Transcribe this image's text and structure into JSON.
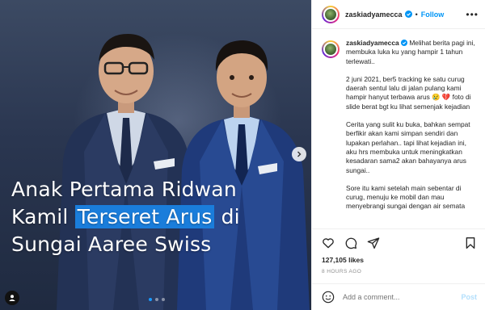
{
  "media": {
    "caption_lines": [
      {
        "parts": [
          "Anak Pertama Ridwan"
        ]
      },
      {
        "before": "Kamil ",
        "highlight": "Terseret Arus",
        "after": " di"
      },
      {
        "parts": [
          "Sungai Aaree Swiss"
        ]
      }
    ],
    "carousel": {
      "total": 3,
      "active": 0
    },
    "next_icon": "chevron-right-icon",
    "tag_icon": "person-tag-icon"
  },
  "post": {
    "username": "zaskiadyamecca",
    "follow_label": "Follow",
    "bullet": "•",
    "more_label": "•••",
    "caption_paragraphs": [
      "Melihat berita pagi ini, membuka luka ku yang hampir 1 tahun terlewati..",
      "2 juni 2021, ber5 tracking ke satu curug daerah sentul lalu di jalan pulang kami hampir hanyut terbawa arus 😢 💔 foto di slide berat bgt ku lihat semenjak kejadian",
      "Cerita yang sulit ku buka, bahkan sempat berfikir akan kami simpan sendiri dan lupakan perlahan.. tapi lihat kejadian ini, aku hrs membuka untuk meningkatkan kesadaran sama2 akan bahayanya arus sungai..",
      "Sore itu kami setelah main sebentar di curug, menuju ke mobil dan mau menyebrangi sungai dengan air semata"
    ],
    "likes": "127,105 likes",
    "time": "8 HOURS AGO",
    "comment_placeholder": "Add a comment...",
    "post_label": "Post",
    "colors": {
      "accent": "#0095f6",
      "highlight": "#1a7ddb"
    }
  }
}
